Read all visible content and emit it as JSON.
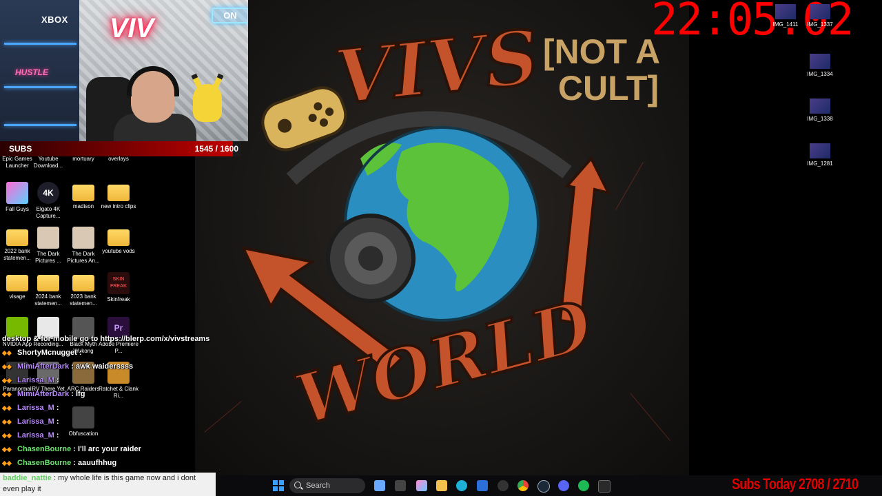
{
  "webcam": {
    "brand_sign": "XBOX",
    "neon_sign": "VIV",
    "hustle_sign": "HUSTLE",
    "on_air_sign": "ON"
  },
  "subs_goal": {
    "label": "SUBS",
    "current": 1545,
    "goal": 1600,
    "count_text": "1545 / 1600",
    "progress_fraction": 0.966
  },
  "desktop_icons": [
    {
      "label": "Epic Games Launcher",
      "icon": "epic-games-icon"
    },
    {
      "label": "Youtube Download...",
      "icon": "youtube-downloader-icon"
    },
    {
      "label": "mortuary",
      "icon": "folder-icon"
    },
    {
      "label": "overlays",
      "icon": "folder-icon"
    },
    {
      "label": "Fall Guys",
      "icon": "fall-guys-icon"
    },
    {
      "label": "Elgato 4K Capture...",
      "icon": "elgato-4k-icon",
      "glyph": "4K"
    },
    {
      "label": "madison",
      "icon": "folder-icon"
    },
    {
      "label": "new intro clips",
      "icon": "folder-icon"
    },
    {
      "label": "2022 bank statemen...",
      "icon": "folder-icon"
    },
    {
      "label": "The Dark Pictures ...",
      "icon": "dark-pictures-icon"
    },
    {
      "label": "The Dark Pictures An...",
      "icon": "dark-pictures-icon"
    },
    {
      "label": "youtube vods",
      "icon": "folder-icon"
    },
    {
      "label": "visage",
      "icon": "folder-icon"
    },
    {
      "label": "2024 bank statemen...",
      "icon": "folder-icon"
    },
    {
      "label": "2023 bank statemen...",
      "icon": "folder-icon"
    },
    {
      "label": "Skinfreak",
      "icon": "skinfreak-icon",
      "glyph": "SKIN FREAK"
    },
    {
      "label": "NVIDIA App",
      "icon": "nvidia-icon"
    },
    {
      "label": "Recording...",
      "icon": "recording-icon"
    },
    {
      "label": "Black Myth Wukong",
      "icon": "black-myth-icon"
    },
    {
      "label": "Adobe Premiere P...",
      "icon": "premiere-icon",
      "glyph": "Pr"
    },
    {
      "label": "Paranormal",
      "icon": "paranormal-icon"
    },
    {
      "label": "RV There Yet",
      "icon": "rv-there-yet-icon"
    },
    {
      "label": "ARC Raiders",
      "icon": "arc-raiders-icon"
    },
    {
      "label": "Ratchet & Clank Ri...",
      "icon": "ratchet-clank-icon"
    },
    {
      "label": "Obfuscation",
      "icon": "obfuscation-icon"
    }
  ],
  "chat": {
    "top_notice": "desktop & for mobile go to https://blerp.com/x/vivstreams",
    "messages": [
      {
        "user": "ShortyMcnugget",
        "message": "",
        "color": "#ffffff"
      },
      {
        "user": "MimiAfterDark",
        "message": "awk waiderssss",
        "color": "#b98bff"
      },
      {
        "user": "Larissa_M",
        "message": "",
        "color": "#b98bff"
      },
      {
        "user": "MimiAfterDark",
        "message": "lfg",
        "color": "#b98bff"
      },
      {
        "user": "Larissa_M",
        "message": "",
        "color": "#b98bff"
      },
      {
        "user": "Larissa_M",
        "message": "",
        "color": "#b98bff"
      },
      {
        "user": "Larissa_M",
        "message": "",
        "color": "#b98bff"
      },
      {
        "user": "ChasenBourne",
        "message": "I'll arc your raider",
        "color": "#6fe36f"
      },
      {
        "user": "ChasenBourne",
        "message": "aauufhhug",
        "color": "#6fe36f"
      }
    ],
    "last_message": {
      "user": "baddie_nattie",
      "message": "my whole life is this game now and i dont even play it"
    }
  },
  "wallpaper": {
    "title_word_1": "VIVS",
    "title_word_2": "WORLD",
    "tagline": "[NOT A CULT]"
  },
  "clock": {
    "time": "22:05:02"
  },
  "right_icons": [
    {
      "label": "IMG_1411"
    },
    {
      "label": "IMG_1337"
    },
    {
      "label": "IMG_1334"
    },
    {
      "label": "IMG_1338"
    },
    {
      "label": "IMG_1281"
    }
  ],
  "taskbar": {
    "search_placeholder": "Search",
    "apps": [
      "start-icon",
      "search-icon",
      "copilot-icon",
      "task-view-icon",
      "photos-icon",
      "file-explorer-icon",
      "edge-icon",
      "store-icon",
      "game-icon",
      "chrome-icon",
      "steam-icon",
      "discord-icon",
      "spotify-icon",
      "terminal-icon"
    ]
  },
  "subs_today": {
    "label": "Subs Today",
    "current": 2708,
    "goal": 2710,
    "text": "Subs Today 2708 / 2710"
  },
  "colors": {
    "clock_red": "#ff0000",
    "subs_red": "#e10000",
    "subs_bar_red": "#c00000",
    "chat_green": "#6fe36f",
    "chat_purple": "#b98bff"
  }
}
